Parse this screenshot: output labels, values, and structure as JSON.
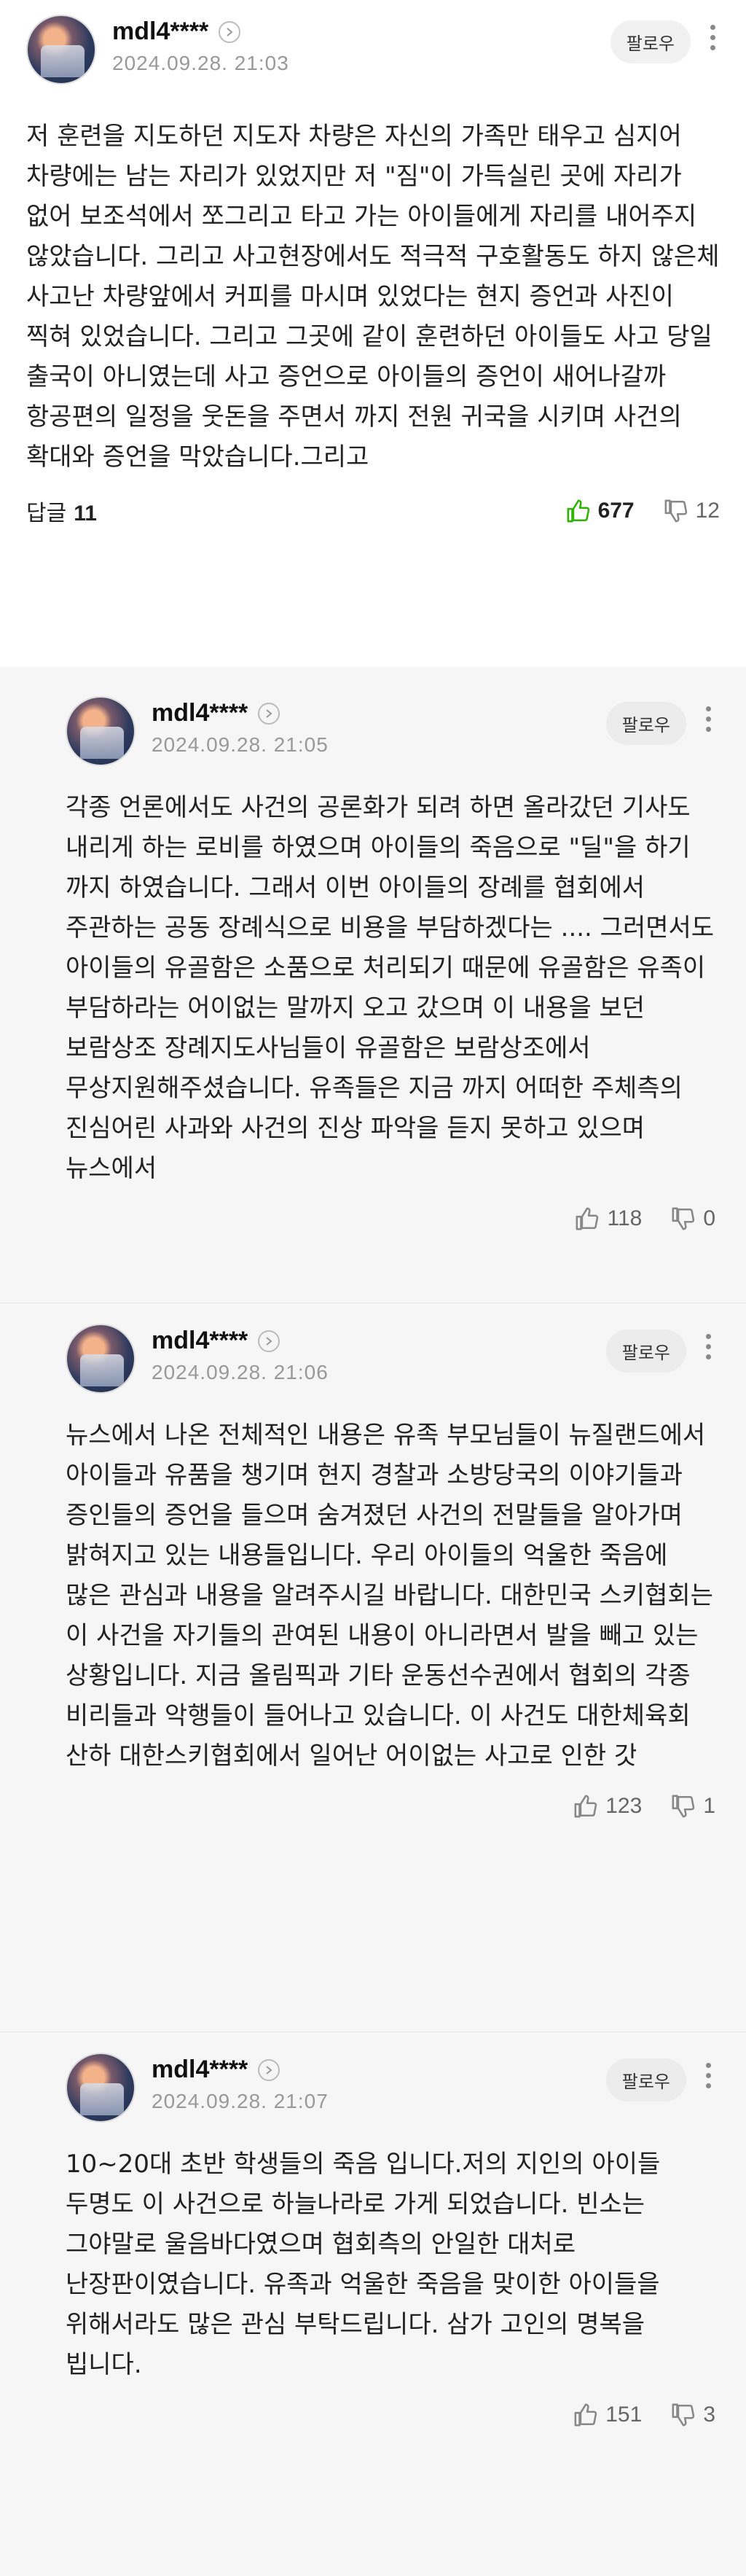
{
  "main_comment": {
    "nickname": "mdl4****",
    "date": "2024.09.28. 21:03",
    "follow_label": "팔로우",
    "text": "저 훈련을 지도하던 지도자 차량은 자신의 가족만 태우고 심지어 차량에는 남는 자리가 있었지만 저 \"짐\"이 가득실린 곳에 자리가 없어 보조석에서 쪼그리고 타고 가는 아이들에게 자리를 내어주지 않았습니다. 그리고 사고현장에서도 적극적 구호활동도 하지 않은체 사고난 차량앞에서 커피를 마시며 있었다는 현지 증언과 사진이 찍혀 있었습니다. 그리고 그곳에 같이 훈련하던 아이들도 사고 당일 출국이 아니였는데 사고 증언으로 아이들의 증언이 새어나갈까 항공편의 일정을 웃돈을 주면서 까지 전원 귀국을 시키며 사건의 확대와 증언을 막았습니다.그리고",
    "reply_label": "답글",
    "reply_count": "11",
    "likes": "677",
    "dislikes": "12",
    "like_color": "#2db400"
  },
  "replies": [
    {
      "nickname": "mdl4****",
      "date": "2024.09.28. 21:05",
      "follow_label": "팔로우",
      "text": "각종 언론에서도 사건의 공론화가 되려 하면 올라갔던 기사도 내리게 하는 로비를 하였으며 아이들의 죽음으로 \"딜\"을 하기 까지 하였습니다. 그래서 이번 아이들의 장례를 협회에서 주관하는 공동 장례식으로 비용을 부담하겠다는 .... 그러면서도 아이들의 유골함은 소품으로 처리되기 때문에 유골함은 유족이 부담하라는 어이없는 말까지 오고 갔으며 이 내용을 보던 보람상조 장례지도사님들이 유골함은 보람상조에서 무상지원해주셨습니다. 유족들은 지금 까지 어떠한 주체측의 진심어린 사과와 사건의 진상 파악을 듣지 못하고 있으며 뉴스에서",
      "likes": "118",
      "dislikes": "0"
    },
    {
      "nickname": "mdl4****",
      "date": "2024.09.28. 21:06",
      "follow_label": "팔로우",
      "text": "뉴스에서 나온 전체적인 내용은 유족 부모님들이 뉴질랜드에서 아이들과 유품을 챙기며 현지 경찰과 소방당국의 이야기들과 증인들의 증언을 들으며 숨겨졌던 사건의 전말들을 알아가며 밝혀지고 있는 내용들입니다. 우리 아이들의 억울한 죽음에 많은 관심과 내용을 알려주시길 바랍니다. 대한민국 스키협회는 이 사건을 자기들의 관여된 내용이 아니라면서 발을 빼고 있는 상황입니다. 지금 올림픽과 기타 운동선수권에서 협회의 각종 비리들과 악행들이 들어나고 있습니다. 이 사건도 대한체육회 산하 대한스키협회에서 일어난 어이없는 사고로 인한 갓",
      "likes": "123",
      "dislikes": "1"
    },
    {
      "nickname": "mdl4****",
      "date": "2024.09.28. 21:07",
      "follow_label": "팔로우",
      "text": "10~20대 초반 학생들의 죽음 입니다.저의 지인의 아이들 두명도 이 사건으로 하늘나라로 가게 되었습니다. 빈소는 그야말로 울음바다였으며 협회측의 안일한 대처로 난장판이였습니다. 유족과 억울한 죽음을 맞이한 아이들을 위해서라도 많은 관심 부탁드립니다. 삼가 고인의 명복을 빕니다.",
      "likes": "151",
      "dislikes": "3"
    }
  ]
}
